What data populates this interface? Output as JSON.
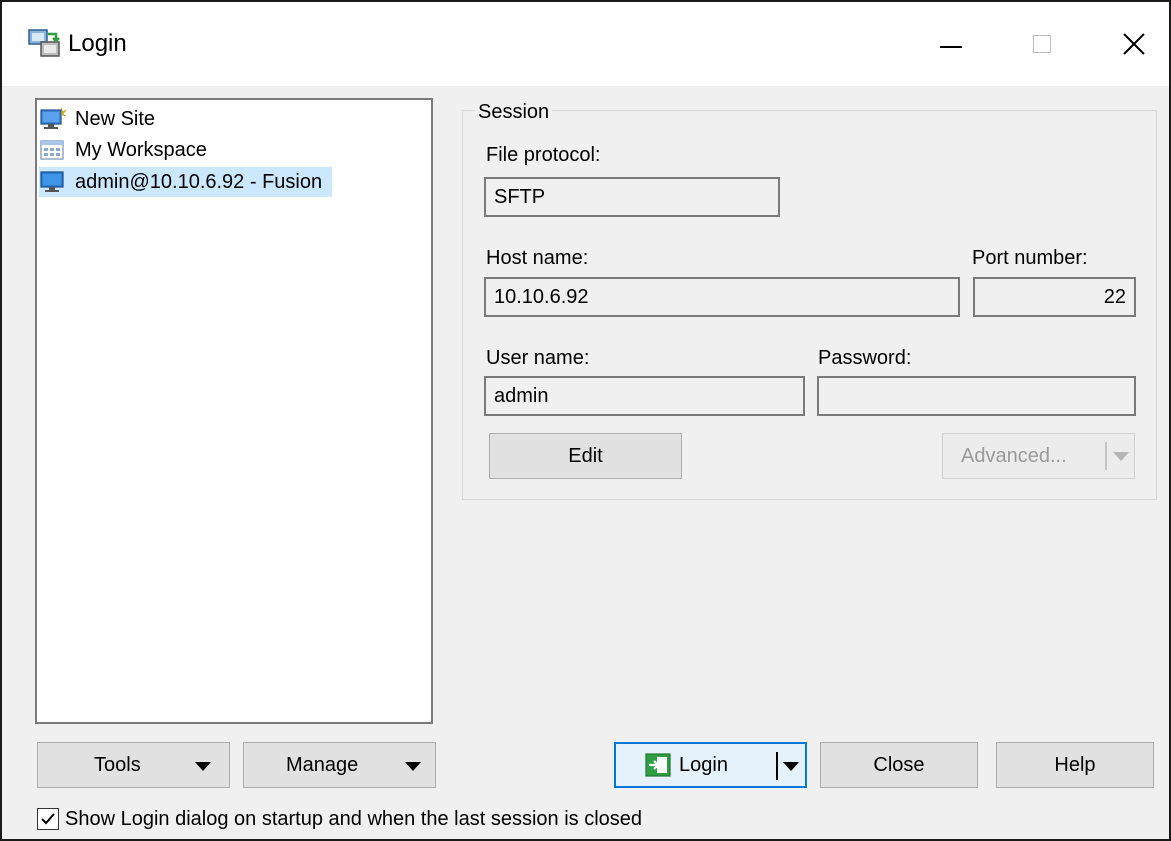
{
  "window": {
    "title": "Login"
  },
  "tree": {
    "items": [
      {
        "label": "New Site",
        "icon": "new-site-icon",
        "selected": false
      },
      {
        "label": "My Workspace",
        "icon": "workspace-icon",
        "selected": false
      },
      {
        "label": "admin@10.10.6.92 - Fusion",
        "icon": "monitor-icon",
        "selected": true
      }
    ]
  },
  "session": {
    "caption": "Session",
    "file_protocol_label": "File protocol:",
    "file_protocol_value": "SFTP",
    "host_label": "Host name:",
    "host_value": "10.10.6.92",
    "port_label": "Port number:",
    "port_value": "22",
    "user_label": "User name:",
    "user_value": "admin",
    "password_label": "Password:",
    "password_value": "",
    "edit_button": "Edit",
    "advanced_button": "Advanced..."
  },
  "buttons": {
    "tools": "Tools",
    "manage": "Manage",
    "login": "Login",
    "close": "Close",
    "help": "Help"
  },
  "footer": {
    "checkbox_label": "Show Login dialog on startup and when the last session is closed",
    "checkbox_checked": true
  },
  "colors": {
    "selection": "#cce8ff",
    "accent": "#0078d7",
    "login_icon_green": "#2ea043"
  }
}
